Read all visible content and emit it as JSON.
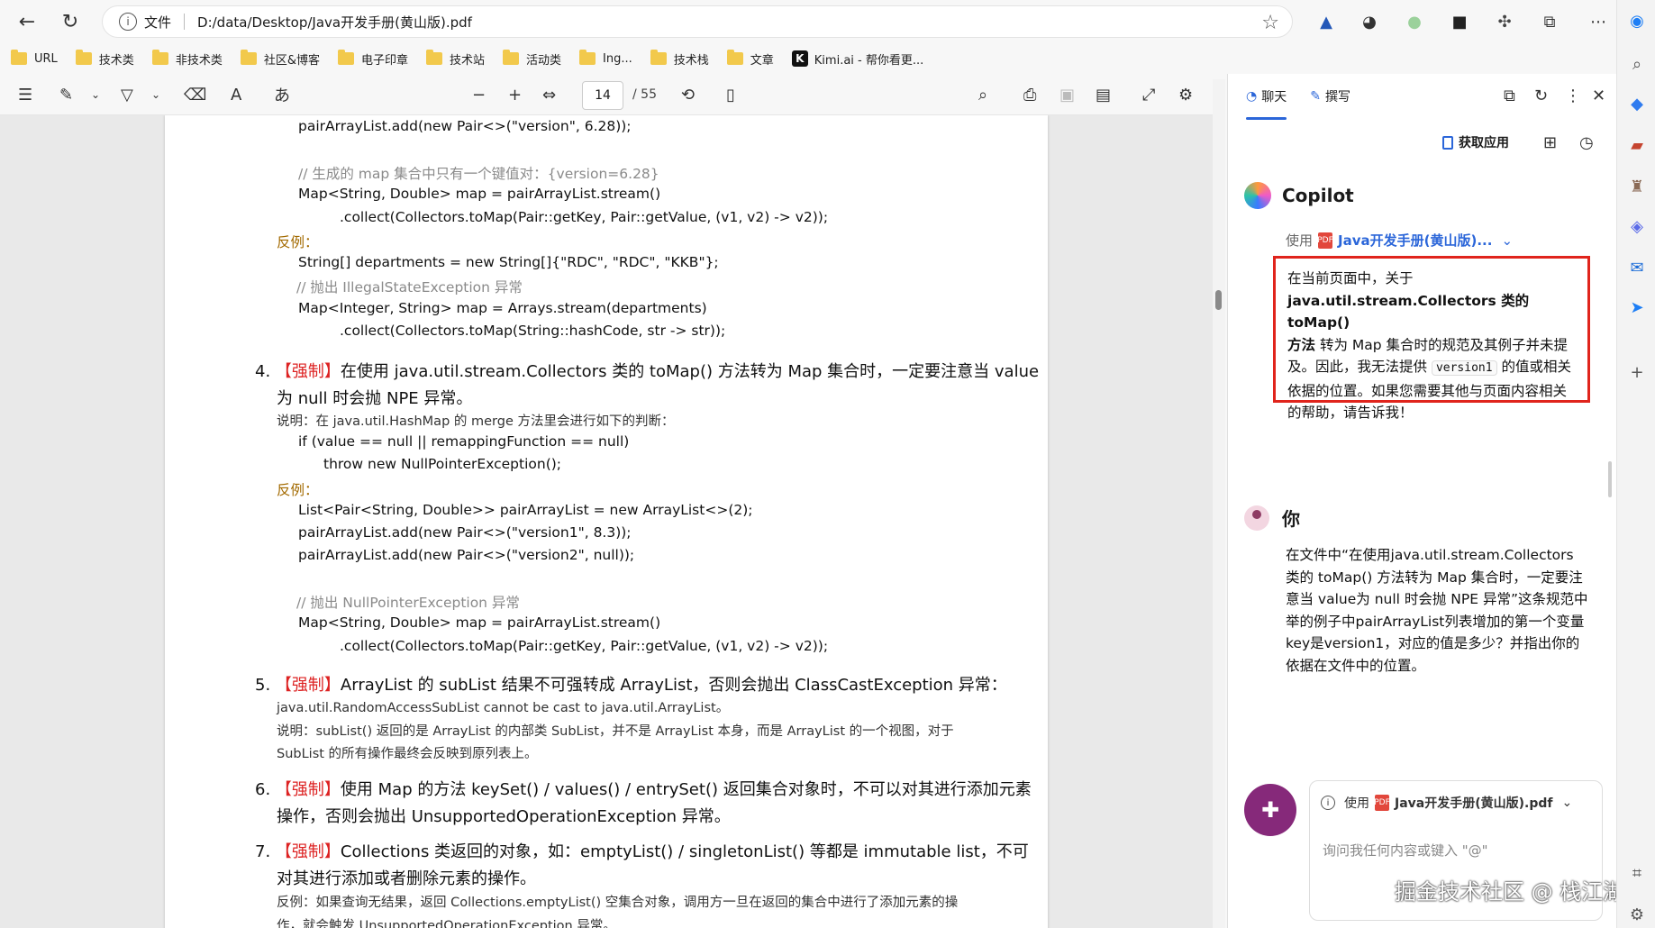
{
  "address": {
    "label": "文件",
    "url": "D:/data/Desktop/Java开发手册(黄山版).pdf"
  },
  "bookmarks": [
    "URL",
    "技术类",
    "非技术类",
    "社区&博客",
    "电子印章",
    "技术站",
    "活动类",
    "Ing...",
    "技术栈",
    "文章",
    "Kimi.ai - 帮你看更..."
  ],
  "pdf": {
    "page": "14",
    "total": "/ 55"
  },
  "doc": {
    "l1": "pairArrayList.add(new Pair<>(\"version\", 6.28));",
    "l2": "// 生成的 map 集合中只有一个键值对：{version=6.28}",
    "l3": "Map<String, Double> map = pairArrayList.stream()",
    "l4": ".collect(Collectors.toMap(Pair::getKey, Pair::getValue, (v1, v2) -> v2));",
    "l5": "反例：",
    "l6": "String[] departments = new String[]{\"RDC\", \"RDC\", \"KKB\"};",
    "l7": "// 抛出 IllegalStateException 异常",
    "l8": "Map<Integer, String> map = Arrays.stream(departments)",
    "l9": ".collect(Collectors.toMap(String::hashCode, str -> str));",
    "i4n": "4.",
    "i4tag": "【强制】",
    "i4a": "在使用 java.util.stream.Collectors 类的 toMap() 方法转为 Map 集合时，一定要注意当 value",
    "i4b": "为 null 时会抛 NPE 异常。",
    "i4note": "说明：在 java.util.HashMap 的 merge 方法里会进行如下的判断：",
    "i4c1": "if (value == null || remappingFunction == null)",
    "i4c2": "throw new NullPointerException();",
    "i4ex": "反例：",
    "i4c3": "List<Pair<String, Double>> pairArrayList = new ArrayList<>(2);",
    "i4c4": "pairArrayList.add(new Pair<>(\"version1\", 8.3));",
    "i4c5": "pairArrayList.add(new Pair<>(\"version2\", null));",
    "i4c6": "// 抛出 NullPointerException 异常",
    "i4c7": "Map<String, Double> map = pairArrayList.stream()",
    "i4c8": ".collect(Collectors.toMap(Pair::getKey, Pair::getValue, (v1, v2) -> v2));",
    "i5n": "5.",
    "i5tag": "【强制】",
    "i5a": "ArrayList 的 subList 结果不可强转成 ArrayList，否则会抛出 ClassCastException 异常：",
    "i5b": "java.util.RandomAccessSubList cannot be cast to java.util.ArrayList。",
    "i5c": "说明：subList() 返回的是 ArrayList 的内部类 SubList，并不是 ArrayList 本身，而是 ArrayList 的一个视图，对于",
    "i5d": "SubList 的所有操作最终会反映到原列表上。",
    "i6n": "6.",
    "i6tag": "【强制】",
    "i6a": "使用 Map 的方法 keySet() / values() / entrySet() 返回集合对象时，不可以对其进行添加元素",
    "i6b": "操作，否则会抛出 UnsupportedOperationException 异常。",
    "i7n": "7.",
    "i7tag": "【强制】",
    "i7a": "Collections 类返回的对象，如：emptyList() / singletonList() 等都是 immutable list，不可",
    "i7b": "对其进行添加或者删除元素的操作。",
    "i7c": "反例：如果查询无结果，返回 Collections.emptyList() 空集合对象，调用方一旦在返回的集合中进行了添加元素的操",
    "i7d": "作，就会触发 UnsupportedOperationException 异常。"
  },
  "sidebar": {
    "tab_chat": "聊天",
    "tab_compose": "撰写",
    "get_app": "获取应用",
    "bot": "Copilot",
    "using": "使用",
    "doc_short": "Java开发手册(黄山版)...",
    "ans1": "在当前页面中，关于",
    "ans2": "java.util.stream.Collectors 类的 toMap()",
    "ans3": "方法",
    "ans4": " 转为 Map 集合时的规范及其例子并未提及。因此，我无法提供 ",
    "ans_code": "version1",
    "ans5": " 的值或相关依据的位置。如果您需要其他与页面内容相关的帮助，请告诉我！",
    "you": "你",
    "question": "在文件中“在使用java.util.stream.Collectors 类的 toMap() 方法转为 Map 集合时，一定要注意当 value为 null 时会抛 NPE 异常”这条规范中举的例子中pairArrayList列表增加的第一个变量key是version1，对应的值是多少？并指出你的依据在文件中的位置。",
    "input_doc": "Java开发手册(黄山版).pdf",
    "placeholder": "询问我任何内容或键入 \"@\""
  },
  "watermark": "掘金技术社区 @ 栈江湖"
}
